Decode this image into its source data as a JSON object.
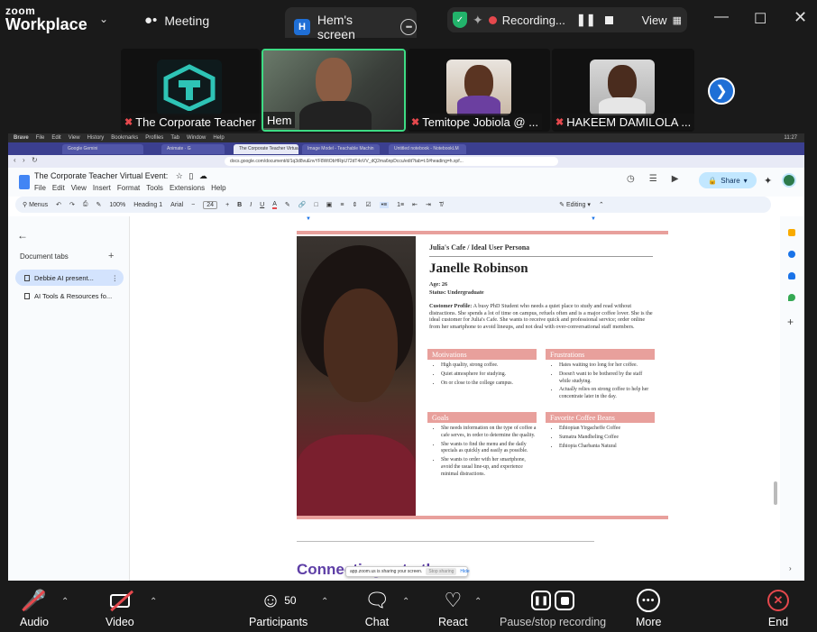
{
  "zoom": {
    "logo_line1": "zoom",
    "logo_line2": "Workplace",
    "meeting_tab": "Meeting",
    "screen_tab_badge": "H",
    "screen_tab": "Hem's screen",
    "recording_label": "Recording...",
    "view_label": "View"
  },
  "gallery": {
    "participants": [
      {
        "name": "The Corporate Teacher",
        "muted": true
      },
      {
        "name": "Hem",
        "muted": false
      },
      {
        "name": "Temitope Jobiola @ ...",
        "muted": true
      },
      {
        "name": "HAKEEM DAMILOLA ...",
        "muted": true
      }
    ]
  },
  "browser": {
    "mac_menu": [
      "Brave",
      "File",
      "Edit",
      "View",
      "History",
      "Bookmarks",
      "Profiles",
      "Tab",
      "Window",
      "Help"
    ],
    "mac_time": "11:27",
    "tabs": [
      "Google Gemini",
      "Animate · G",
      "The Corporate Teacher Virtua",
      "Image Model - Teachable Machin",
      "Untitled notebook - NotebookLM"
    ],
    "url": "docs.google.com/document/d/1q3d8vuEnvYF8WtObHRpU72dT4oVV_dQ2ma6npDccu/edit?tab=t.0#heading=h.xpf..."
  },
  "doc": {
    "title": "The Corporate Teacher Virtual Event:",
    "menu": [
      "File",
      "Edit",
      "View",
      "Insert",
      "Format",
      "Tools",
      "Extensions",
      "Help"
    ],
    "share_label": "Share",
    "toolbar": {
      "menus": "Menus",
      "zoom": "100%",
      "style": "Heading 1",
      "font": "Arial",
      "size": "24",
      "mode": "Editing"
    },
    "outline": {
      "header": "Document tabs",
      "items": [
        "Debbie AI present...",
        "AI Tools & Resources fo..."
      ]
    },
    "persona": {
      "breadcrumb": "Julia's Cafe / Ideal User Persona",
      "name": "Janelle Robinson",
      "age": "Age: 26",
      "status": "Status: Undergraduate",
      "profile_label": "Customer Profile:",
      "profile_text": " A busy PhD Student who needs a quiet place to study and read without distractions. She spends a lot of time on campus, refuels often and is a major coffee lover. She is the ideal customer for Julia's Cafe. She wants to receive quick and professional service; order online from her smartphone to avoid lineups, and not deal with over-conversational staff members.",
      "sections": {
        "motivations": {
          "title": "Motivations",
          "items": [
            "High quality, strong coffee.",
            "Quiet atmosphere for studying.",
            "On or close to the college campus."
          ]
        },
        "frustrations": {
          "title": "Frustrations",
          "items": [
            "Hates waiting too long for her coffee.",
            "Doesn't want to be bothered by the staff while studying.",
            "Actually relies on strong coffee to help her concentrate later in the day."
          ]
        },
        "goals": {
          "title": "Goals",
          "items": [
            "She needs information on the type of coffee a cafe serves, in order to determine the quality.",
            "She wants to find the menu and the daily specials as quickly and easily as possible.",
            "She wants to order with her smartphone, avoid the usual line-up, and experience minimal distractions."
          ]
        },
        "beans": {
          "title": "Favorite Coffee Beans",
          "items": [
            "Ethiopian Yirgacheffe Coffee",
            "Sumatra Mandheling Coffee",
            "Ethiopia Charbanta Natural"
          ]
        }
      }
    },
    "next_heading": "Connecting ... to the",
    "share_notice": "app.zoom.us is sharing your screen.",
    "stop_sharing": "Stop sharing",
    "hide": "Hide"
  },
  "controls": {
    "audio": "Audio",
    "video": "Video",
    "participants": "Participants",
    "participant_count": "50",
    "chat": "Chat",
    "react": "React",
    "record": "Pause/stop recording",
    "more": "More",
    "end": "End"
  },
  "colors": {
    "accent": "#1f6fd6",
    "persona_band": "#e8a09c",
    "danger": "#e5484d",
    "heading_purple": "#5e3fa6"
  }
}
